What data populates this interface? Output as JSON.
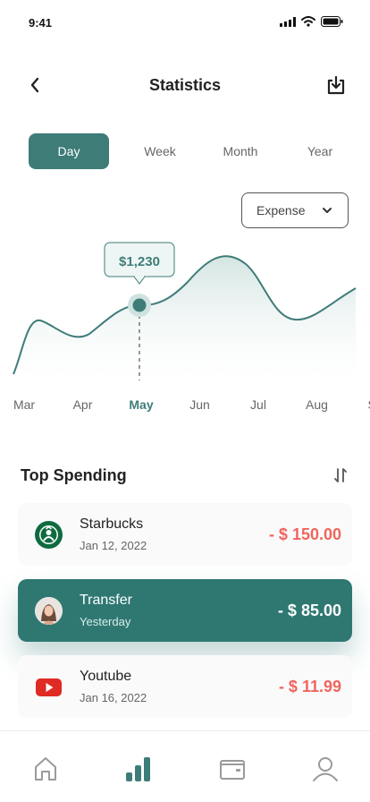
{
  "status": {
    "time": "9:41",
    "icons": [
      "signal-icon",
      "wifi-icon",
      "battery-icon"
    ]
  },
  "header": {
    "title": "Statistics",
    "back_icon": "back-arrow-icon",
    "download_icon": "download-icon"
  },
  "tabs": [
    {
      "label": "Day",
      "active": true
    },
    {
      "label": "Week",
      "active": false
    },
    {
      "label": "Month",
      "active": false
    },
    {
      "label": "Year",
      "active": false
    }
  ],
  "filter": {
    "selected": "Expense",
    "icon": "chevron-down-icon"
  },
  "chart_data": {
    "type": "area",
    "x": [
      "Mar",
      "Apr",
      "May",
      "Jun",
      "Jul",
      "Aug",
      "Se"
    ],
    "highlight": {
      "category": "May",
      "label": "$1,230"
    },
    "colors": {
      "line": "#3e7c78",
      "fill": "#e3efed",
      "active_label": "#3e7c78"
    }
  },
  "spending": {
    "title": "Top Spending",
    "sort_icon": "sort-icon",
    "items": [
      {
        "name": "Starbucks",
        "date": "Jan 12, 2022",
        "amount": "- $ 150.00",
        "icon": "starbucks-logo-icon"
      },
      {
        "name": "Transfer",
        "date": "Yesterday",
        "amount": "- $ 85.00",
        "icon": "avatar",
        "highlighted": true
      },
      {
        "name": "Youtube",
        "date": "Jan 16, 2022",
        "amount": "- $ 11.99",
        "icon": "youtube-logo-icon"
      }
    ]
  },
  "nav": [
    {
      "icon": "home-icon",
      "active": false
    },
    {
      "icon": "chart-icon",
      "active": true
    },
    {
      "icon": "wallet-icon",
      "active": false
    },
    {
      "icon": "user-icon",
      "active": false
    }
  ],
  "colors": {
    "primary": "#3e7c78",
    "negative": "#f0655e"
  }
}
